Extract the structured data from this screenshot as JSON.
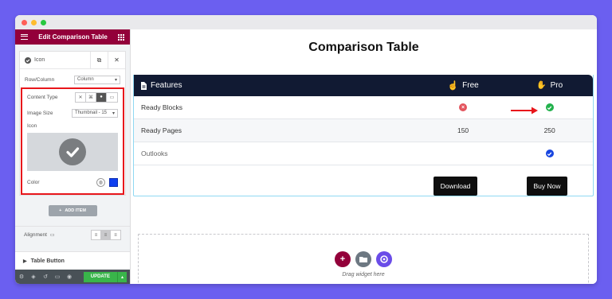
{
  "colors": {
    "background": "#6b5ff0",
    "brand": "#93003a",
    "header_dark": "#111a33",
    "highlight_red": "#e8161b",
    "update_green": "#39b54a",
    "swatch_blue": "#0f3ff0"
  },
  "sidebar": {
    "header_title": "Edit Comparison Table",
    "menu_icon": "hamburger-icon",
    "apps_icon": "grid-icon",
    "item": {
      "label": "Icon",
      "duplicate_icon": "duplicate-icon",
      "remove_icon": "close-icon"
    },
    "row_column": {
      "label": "Row/Column",
      "value": "Column"
    },
    "content_type": {
      "label": "Content Type",
      "options": [
        "none-icon",
        "image-icon",
        "icon-icon",
        "template-icon"
      ],
      "selected_index": 2
    },
    "image_size": {
      "label": "Image Size",
      "value": "Thumbnail - 15"
    },
    "icon_label": "Icon",
    "color_label": "Color",
    "add_item": "ADD ITEM",
    "alignment": {
      "label": "Alignment",
      "options": [
        "align-left-icon",
        "align-center-icon",
        "align-right-icon"
      ],
      "selected_index": 1
    },
    "table_button_section": "Table Button",
    "footer": {
      "icons": [
        "settings-icon",
        "layers-icon",
        "history-icon",
        "responsive-icon",
        "preview-icon"
      ],
      "update_label": "UPDATE"
    }
  },
  "main": {
    "page_title": "Comparison Table",
    "table": {
      "headers": {
        "features": "Features",
        "free": "Free",
        "pro": "Pro"
      },
      "rows": [
        {
          "feature": "Ready Blocks",
          "free": "cross-icon",
          "pro": "check-icon"
        },
        {
          "feature": "Ready Pages",
          "free": "150",
          "pro": "250"
        },
        {
          "feature": "Outlooks",
          "free": "",
          "pro": "check-blue-icon"
        }
      ],
      "buttons": {
        "free": "Download",
        "pro": "Buy Now"
      }
    },
    "drop_zone": {
      "text": "Drag widget here",
      "buttons": [
        "add-section-icon",
        "add-template-icon",
        "elementskit-icon"
      ]
    }
  }
}
